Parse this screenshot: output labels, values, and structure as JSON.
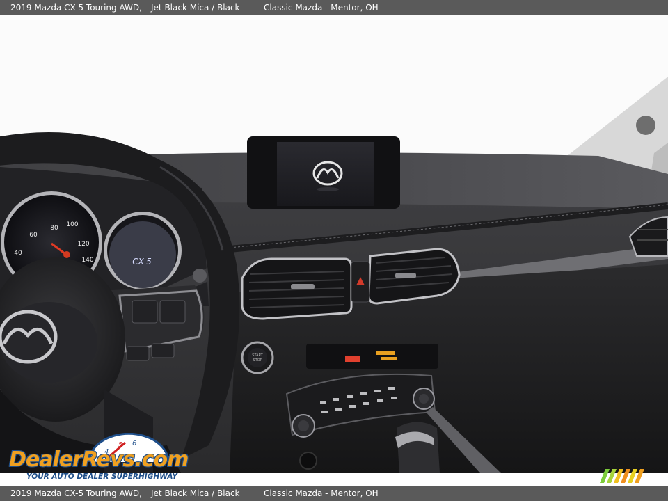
{
  "caption": {
    "vehicle": "2019 Mazda CX-5 Touring AWD,",
    "color": "Jet Black Mica / Black",
    "dealer": "Classic Mazda - Mentor, OH"
  },
  "photo": {
    "subject": "dashboard-interior"
  },
  "watermark": {
    "brand": "DealerRevs.com",
    "tagline": "YOUR AUTO DEALER SUPERHIGHWAY"
  },
  "colors": {
    "caption_bar": "#5a5a5a",
    "watermark_orange": "#f0a020",
    "watermark_blue": "#1f4f8a"
  }
}
